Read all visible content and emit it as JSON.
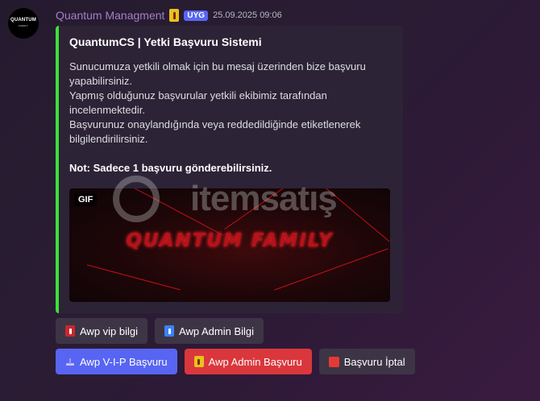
{
  "message": {
    "avatar_text": "QUANTUM",
    "avatar_subtext": "FAMILY",
    "username": "Quantum Managment",
    "tag": "UYG",
    "timestamp": "25.09.2025 09:06"
  },
  "embed": {
    "accent_color": "#3be03b",
    "title": "QuantumCS | Yetki Başvuru Sistemi",
    "description_lines": [
      "Sunucumuza yetkili olmak için bu mesaj üzerinden bize başvuru yapabilirsiniz.",
      "Yapmış olduğunuz başvurular yetkili ekibimiz tarafından incelenmektedir.",
      "Başvurunuz onaylandığında veya reddedildiğinde etiketlenerek bilgilendirilirsiniz."
    ],
    "note": "Not: Sadece 1 başvuru gönderebilirsiniz.",
    "image": {
      "badge": "GIF",
      "banner_text": "QUANTUM FAMILY"
    }
  },
  "watermark": {
    "text": "itemsatış"
  },
  "buttons": {
    "row1": [
      {
        "label": "Awp vip bilgi",
        "icon": "red-pin-icon",
        "style": "grey"
      },
      {
        "label": "Awp Admin Bilgi",
        "icon": "blue-pin-icon",
        "style": "grey"
      }
    ],
    "row2": [
      {
        "label": "Awp V-I-P Başvuru",
        "icon": "joystick-icon",
        "style": "blurple"
      },
      {
        "label": "Awp Admin Başvuru",
        "icon": "gold-pin-icon",
        "style": "red"
      },
      {
        "label": "Başvuru İptal",
        "icon": "stop-icon",
        "style": "grey"
      }
    ]
  },
  "colors": {
    "blurple": "#5865f2",
    "danger": "#da373c",
    "secondary": "#3d3545",
    "username": "#a57fc5"
  }
}
